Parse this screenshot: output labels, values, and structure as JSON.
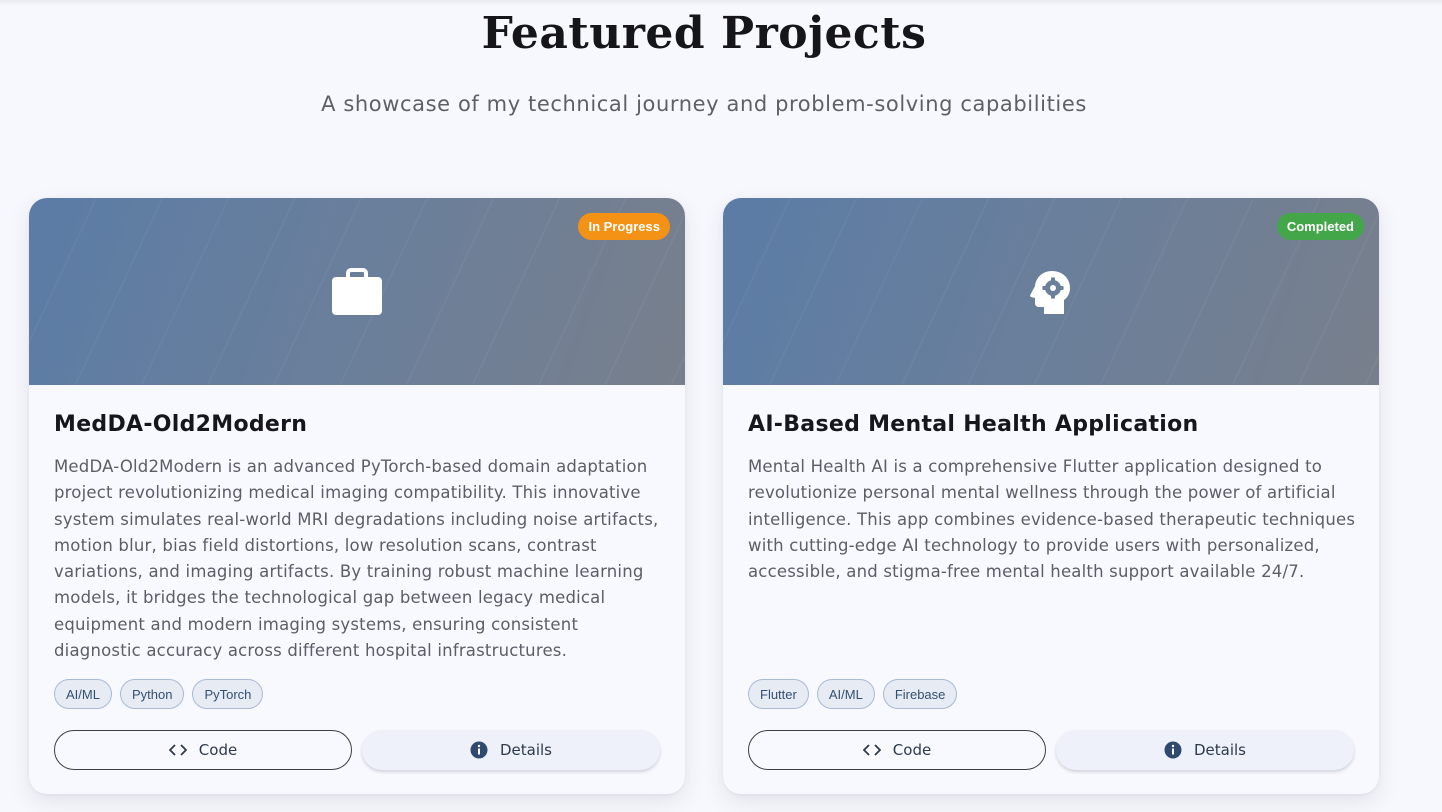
{
  "header": {
    "title": "Featured Projects",
    "subtitle": "A showcase of my technical journey and problem-solving capabilities"
  },
  "projects": [
    {
      "icon": "briefcase-icon",
      "status": "In Progress",
      "status_color": "#f39215",
      "title": "MedDA-Old2Modern",
      "description": "MedDA-Old2Modern is an advanced PyTorch-based domain adaptation project revolutionizing medical imaging compatibility. This innovative system simulates real-world MRI degradations including noise artifacts, motion blur, bias field distortions, low resolution scans, contrast variations, and imaging artifacts. By training robust machine learning models, it bridges the technological gap between legacy medical equipment and modern imaging systems, ensuring consistent diagnostic accuracy across different hospital infrastructures.",
      "tags": [
        "AI/ML",
        "Python",
        "PyTorch"
      ],
      "code_label": "Code",
      "details_label": "Details"
    },
    {
      "icon": "brain-gear-icon",
      "status": "Completed",
      "status_color": "#43a74a",
      "title": "AI-Based Mental Health Application",
      "description": "Mental Health AI is a comprehensive Flutter application designed to revolutionize personal mental wellness through the power of artificial intelligence. This app combines evidence-based therapeutic techniques with cutting-edge AI technology to provide users with personalized, accessible, and stigma-free mental health support available 24/7.",
      "tags": [
        "Flutter",
        "AI/ML",
        "Firebase"
      ],
      "code_label": "Code",
      "details_label": "Details"
    }
  ],
  "colors": {
    "background": "#f7f8fd",
    "banner_start": "#5b7ca6",
    "banner_end": "#787f8c",
    "tag_background": "#e6ebf4",
    "tag_text": "#34506f"
  }
}
